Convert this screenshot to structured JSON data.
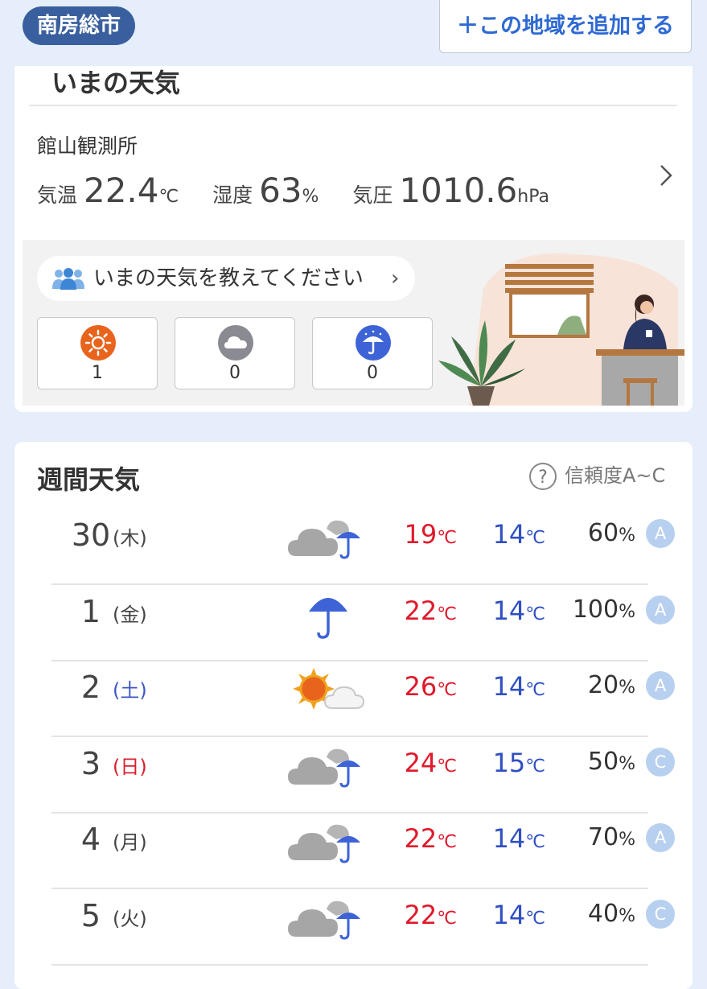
{
  "header": {
    "city": "南房総市",
    "add_label": "＋この地域を追加する"
  },
  "now": {
    "title": "いまの天気",
    "station": "館山観測所",
    "temp_label": "気温",
    "temp_value": "22.4",
    "temp_unit": "℃",
    "humidity_label": "湿度",
    "humidity_value": "63",
    "humidity_unit": "%",
    "pressure_label": "気圧",
    "pressure_value": "1010.6",
    "pressure_unit": "hPa"
  },
  "report": {
    "prompt": "いまの天気を教えてください",
    "arrow": "›",
    "votes": [
      {
        "icon": "sun-icon",
        "count": "1"
      },
      {
        "icon": "cloud-icon",
        "count": "0"
      },
      {
        "icon": "umbrella-icon",
        "count": "0"
      }
    ]
  },
  "weekly": {
    "title": "週間天気",
    "reliability_label": "信頼度A~C",
    "help_glyph": "?",
    "temp_unit": "℃",
    "pop_unit": "%",
    "days": [
      {
        "date": "30",
        "dow": "(木)",
        "weather": "cloud-rain",
        "high": "19",
        "low": "14",
        "pop": "60",
        "rel": "A"
      },
      {
        "date": "1",
        "dow": "(金)",
        "weather": "rain",
        "high": "22",
        "low": "14",
        "pop": "100",
        "rel": "A"
      },
      {
        "date": "2",
        "dow": "(土)",
        "weather": "sun-cloud",
        "high": "26",
        "low": "14",
        "pop": "20",
        "rel": "A"
      },
      {
        "date": "3",
        "dow": "(日)",
        "weather": "cloud-rain",
        "high": "24",
        "low": "15",
        "pop": "50",
        "rel": "C"
      },
      {
        "date": "4",
        "dow": "(月)",
        "weather": "cloud-rain",
        "high": "22",
        "low": "14",
        "pop": "70",
        "rel": "A"
      },
      {
        "date": "5",
        "dow": "(火)",
        "weather": "cloud-rain",
        "high": "22",
        "low": "14",
        "pop": "40",
        "rel": "C"
      }
    ]
  },
  "colors": {
    "high": "#e0192b",
    "low": "#2f4fc2",
    "badge": "#3a5f9e",
    "accent": "#2f6ad3"
  }
}
